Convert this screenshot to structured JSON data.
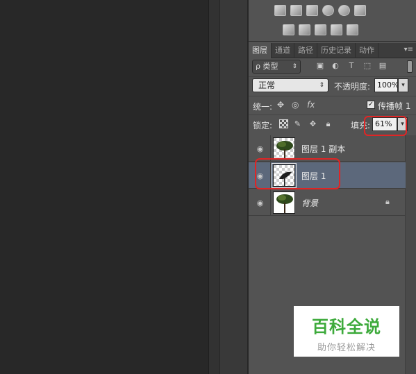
{
  "tabs": [
    "图层",
    "通道",
    "路径",
    "历史记录",
    "动作"
  ],
  "filter": {
    "kind_label": "类型",
    "search_prefix": "ρ"
  },
  "blend": {
    "mode": "正常",
    "opacity_label": "不透明度:",
    "opacity_value": "100%"
  },
  "unify": {
    "label": "统一:",
    "propagate_label": "传播帧 1",
    "propagate_checked": true
  },
  "lock": {
    "label": "锁定:",
    "fill_label": "填充:",
    "fill_value": "61%"
  },
  "layers": [
    {
      "name": "图层 1 副本",
      "visible": true,
      "selected": false,
      "locked": false
    },
    {
      "name": "图层 1",
      "visible": true,
      "selected": true,
      "locked": false
    },
    {
      "name": "背景",
      "visible": true,
      "selected": false,
      "locked": true
    }
  ],
  "watermark": {
    "main": "百科全说",
    "sub": "助你轻松解决"
  },
  "colors": {
    "selected_row": "#5c687b",
    "highlight": "#e02525",
    "watermark_green": "#3daa3b"
  }
}
